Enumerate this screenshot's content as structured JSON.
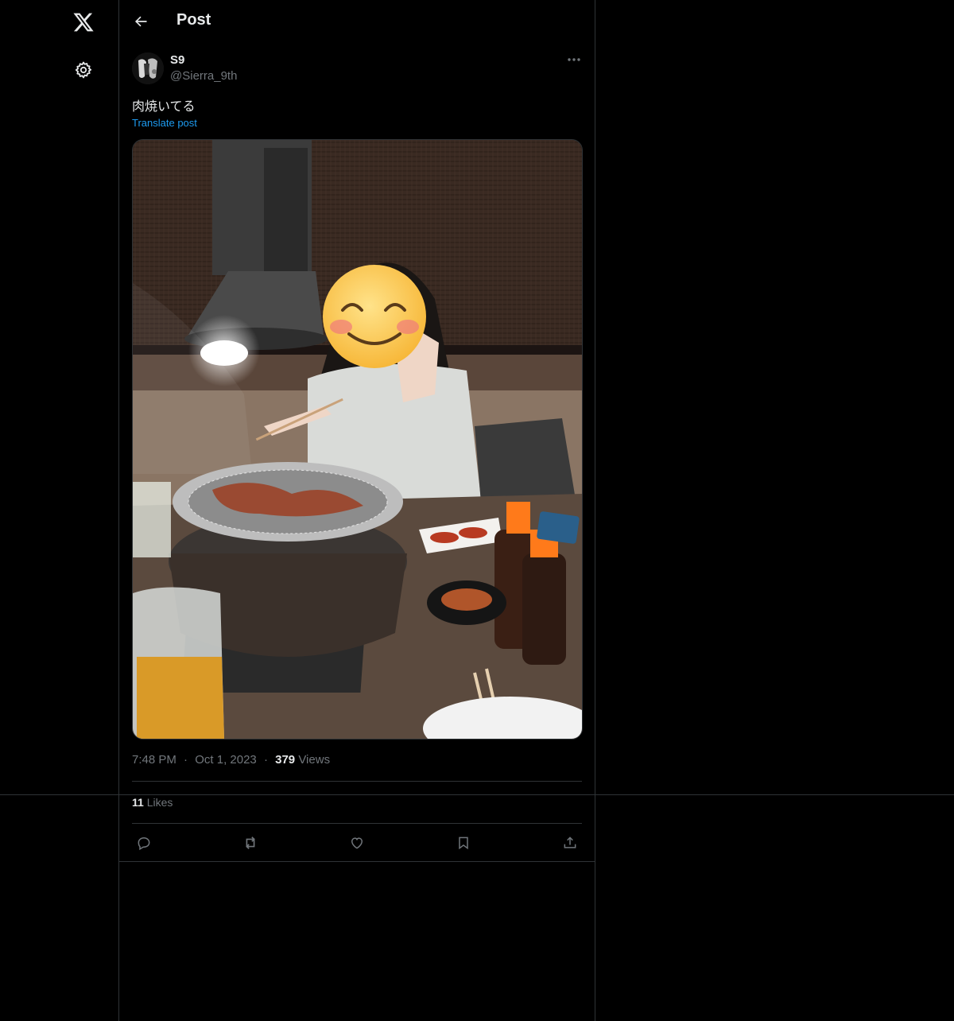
{
  "header": {
    "title": "Post"
  },
  "post": {
    "author_name": "S9",
    "author_handle": "@Sierra_9th",
    "text": "肉焼いてる",
    "translate_label": "Translate post",
    "time": "7:48 PM",
    "date": "Oct 1, 2023",
    "views_count": "379",
    "views_label": "Views",
    "likes_count": "11",
    "likes_label": "Likes",
    "separator": "·"
  },
  "icons": {
    "logo": "x-logo-icon",
    "settings": "gear-icon",
    "back": "arrow-left-icon",
    "more": "more-horizontal-icon",
    "reply": "reply-icon",
    "repost": "repost-icon",
    "like": "heart-icon",
    "bookmark": "bookmark-icon",
    "share": "share-icon"
  },
  "colors": {
    "background": "#000000",
    "link": "#1d9bf0",
    "muted": "#71767b",
    "text": "#e7e9ea",
    "border": "#2f3336"
  }
}
